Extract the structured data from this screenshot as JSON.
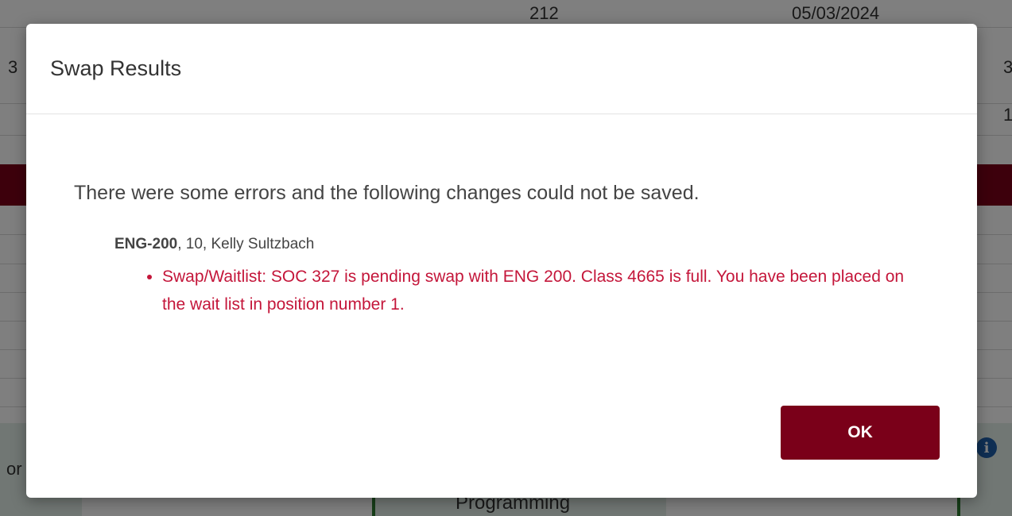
{
  "background": {
    "row_value": "212",
    "row_date": "05/03/2024",
    "left_fragment": "3",
    "right_fragment_1": "3",
    "right_fragment_2": "1",
    "bottom_left_fragment": "or",
    "bottom_center_text": "Programming",
    "info_icon": "info-icon",
    "accent_color": "#7a0019"
  },
  "modal": {
    "title": "Swap Results",
    "intro": "There were some errors and the following changes could not be saved.",
    "detail": {
      "course": "ENG-200",
      "rest": ", 10, Kelly Sultzbach"
    },
    "errors": [
      "Swap/Waitlist: SOC 327 is pending swap with ENG 200.  Class 4665 is full. You have been placed on the wait list in position number 1."
    ],
    "ok_label": "OK",
    "error_color": "#c4163a",
    "button_color": "#7a0019"
  }
}
